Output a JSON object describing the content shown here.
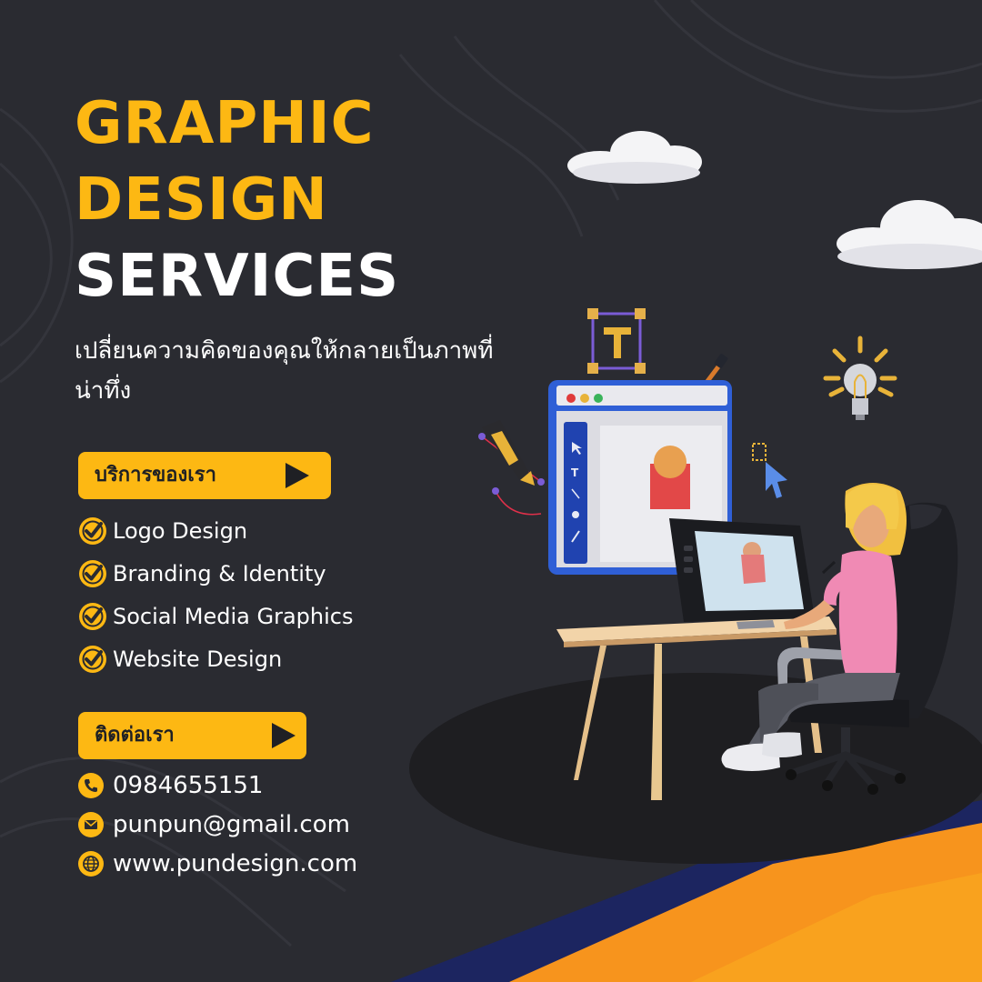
{
  "title": {
    "line1": "GRAPHIC",
    "line2": "DESIGN",
    "line3": "SERVICES"
  },
  "subtitle": "เปลี่ยนความคิดของคุณให้กลายเป็นภาพที่น่าทึ่ง",
  "services_button": {
    "label": "บริการของเรา",
    "icon": "play-arrow-icon"
  },
  "services": [
    {
      "label": "Logo Design",
      "icon": "check-circle-icon"
    },
    {
      "label": "Branding & Identity",
      "icon": "check-circle-icon"
    },
    {
      "label": "Social Media Graphics",
      "icon": "check-circle-icon"
    },
    {
      "label": "Website Design",
      "icon": "check-circle-icon"
    }
  ],
  "contact_button": {
    "label": "ติดต่อเรา",
    "icon": "play-arrow-icon"
  },
  "contacts": [
    {
      "value": "0984655151",
      "icon": "phone-icon"
    },
    {
      "value": "punpun@gmail.com",
      "icon": "mail-icon"
    },
    {
      "value": "www.pundesign.com",
      "icon": "globe-icon"
    }
  ],
  "colors": {
    "background": "#2a2b31",
    "accent": "#fdb813",
    "orange": "#f7941d",
    "text": "#ffffff"
  }
}
